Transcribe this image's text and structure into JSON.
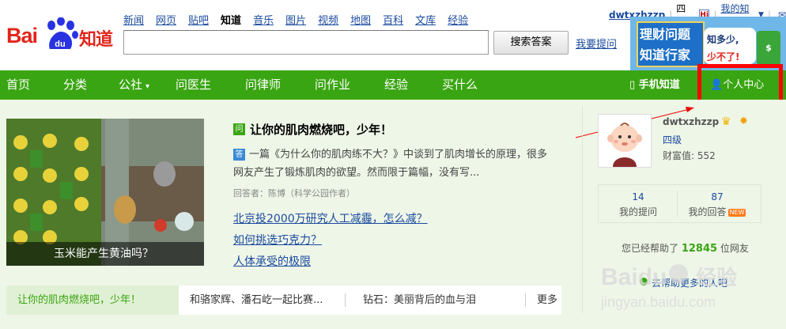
{
  "logo": {
    "bai": "Bai",
    "du": "du",
    "zhidao": "知道"
  },
  "top_nav": [
    {
      "label": "新闻",
      "current": false
    },
    {
      "label": "网页",
      "current": false
    },
    {
      "label": "贴吧",
      "current": false
    },
    {
      "label": "知道",
      "current": true
    },
    {
      "label": "音乐",
      "current": false
    },
    {
      "label": "图片",
      "current": false
    },
    {
      "label": "视频",
      "current": false
    },
    {
      "label": "地图",
      "current": false
    },
    {
      "label": "百科",
      "current": false
    },
    {
      "label": "文库",
      "current": false
    },
    {
      "label": "经验",
      "current": false
    }
  ],
  "search": {
    "value": "",
    "button": "搜索答案",
    "ask_link": "我要提问"
  },
  "user_bar": {
    "username": "dwtxzhzzp",
    "level": "四级",
    "hi_icon": "Hi",
    "mine": "我的知道",
    "message_icon": "mail-icon"
  },
  "ad": {
    "line1": "理财问题",
    "line2": "知道行家",
    "line3": "知多少,",
    "line4": "少不了!",
    "tag": "$"
  },
  "main_nav": {
    "items": [
      "首页",
      "分类",
      "公社",
      "问医生",
      "问律师",
      "问作业",
      "经验",
      "买什么"
    ],
    "mobile": "手机知道",
    "personal_center": "个人中心"
  },
  "feature": {
    "caption": "玉米能产生黄油吗？",
    "question": "让你的肌肉燃烧吧，少年！",
    "q_badge": "问",
    "a_badge": "答",
    "answer": "一篇《为什么你的肌肉练不大？》中谈到了肌肉增长的原理，很多网友产生了锻炼肌肉的欲望。然而限于篇幅，没有写...",
    "author": "回答者：陈博（科学公园作者）",
    "links": [
      "北京投2000万研究人工减霾，怎么减？",
      "如何挑选巧克力？",
      "人体承受的极限"
    ]
  },
  "bottom_bar": {
    "highlight": "让你的肌肉燃烧吧，少年！",
    "item2": "和骆家辉、潘石屹一起比赛...",
    "item3": "钻石：美丽背后的血与泪",
    "more": "更多"
  },
  "profile": {
    "username": "dwtxzhzzp",
    "level": "四级",
    "wealth_label": "财富值:",
    "wealth": "552",
    "questions_count": "14",
    "questions_label": "我的提问",
    "answers_count": "87",
    "answers_label": "我的回答",
    "new_badge": "NEW",
    "helped_prefix": "您已经帮助了",
    "helped_count": "12845",
    "helped_suffix": "位网友",
    "help_link": "去帮助更多的人吧"
  },
  "watermark": {
    "brand": "Baidu",
    "text": "经验",
    "url": "jingyan.baidu.com"
  },
  "colors": {
    "green": "#3aa512",
    "red": "#e1251b",
    "link": "#1a4a9e",
    "highlight_box": "#ff0000"
  }
}
